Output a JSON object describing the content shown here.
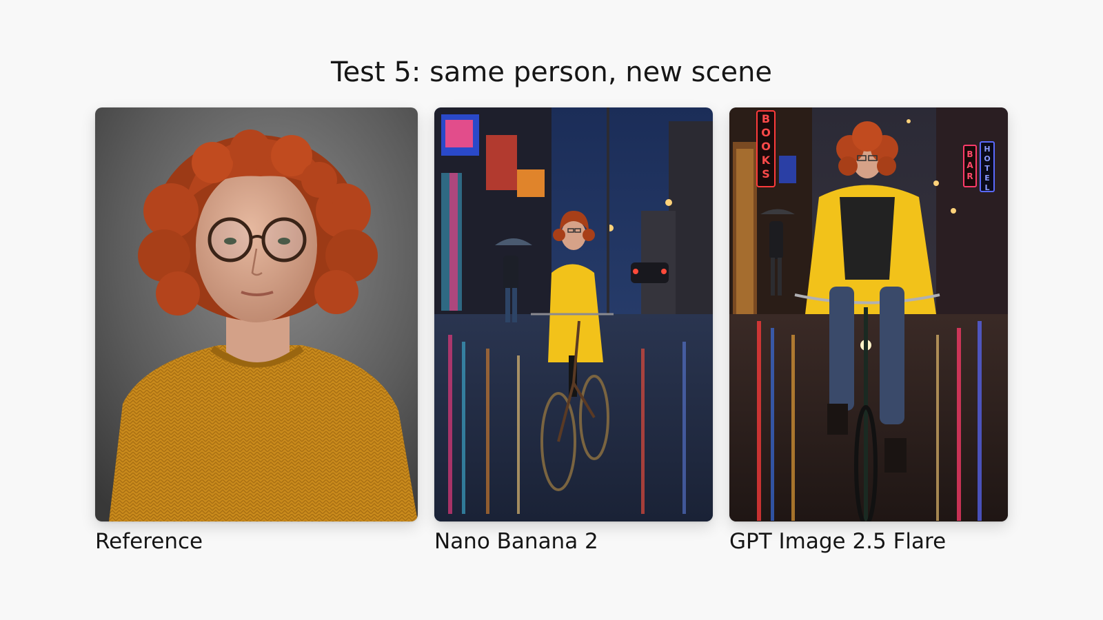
{
  "title": "Test 5: same person, new scene",
  "panels": [
    {
      "caption": "Reference",
      "image_description": "Studio portrait of a woman with curly red hair, round glasses and a mustard knit sweater against a grey backdrop"
    },
    {
      "caption": "Nano Banana 2",
      "image_description": "The same woman in a yellow raincoat riding a bicycle down a rainy neon-lit street at dusk"
    },
    {
      "caption": "GPT Image 2.5 Flare",
      "image_description": "The same woman in a yellow rain jacket riding a bicycle toward the camera on a wet city street with neon signs",
      "signs": [
        "BOOKS",
        "BAR",
        "HOTEL"
      ]
    }
  ],
  "colors": {
    "background": "#f8f8f8",
    "hair": "#b4441c",
    "sweater": "#c98a1c",
    "raincoat": "#f2c21a",
    "night_sky": "#1b2d58"
  }
}
